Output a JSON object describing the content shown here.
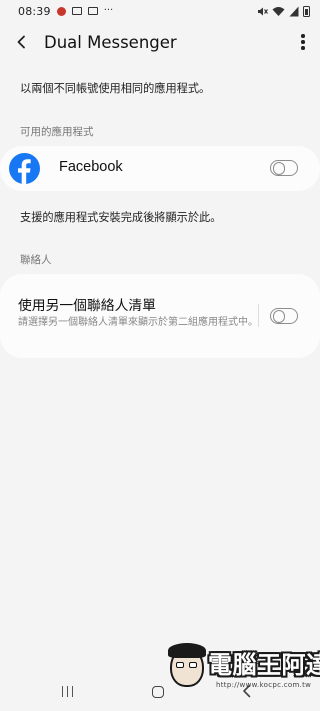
{
  "status_bar": {
    "time": "08:39",
    "more_indicator": "···",
    "left_icons": [
      "tomato-app-icon",
      "image-icon",
      "gallery-icon"
    ],
    "right_icons": [
      "mute-icon",
      "wifi-icon",
      "signal-icon",
      "battery-icon"
    ]
  },
  "app_bar": {
    "title": "Dual Messenger",
    "back_icon": "back-arrow-icon",
    "more_icon": "more-vertical-icon"
  },
  "description": "以兩個不同帳號使用相同的應用程式。",
  "available_apps": {
    "header": "可用的應用程式",
    "items": [
      {
        "label": "Facebook",
        "icon": "facebook-icon",
        "enabled": false
      }
    ]
  },
  "info_text": "支援的應用程式安裝完成後將顯示於此。",
  "contacts": {
    "header": "聯絡人",
    "title": "使用另一個聯絡人清單",
    "subtitle": "請選擇另一個聯絡人清單來顯示於第二組應用程式中。",
    "enabled": false
  },
  "nav_bar": {
    "icons": [
      "recents-icon",
      "home-icon",
      "back-icon"
    ]
  },
  "watermark": {
    "text": "電腦王阿達",
    "url": "http://www.kocpc.com.tw"
  },
  "colors": {
    "background": "#f4f4f4",
    "card": "#fcfcfc",
    "facebook_blue": "#1877f2",
    "secondary_text": "#888888"
  }
}
